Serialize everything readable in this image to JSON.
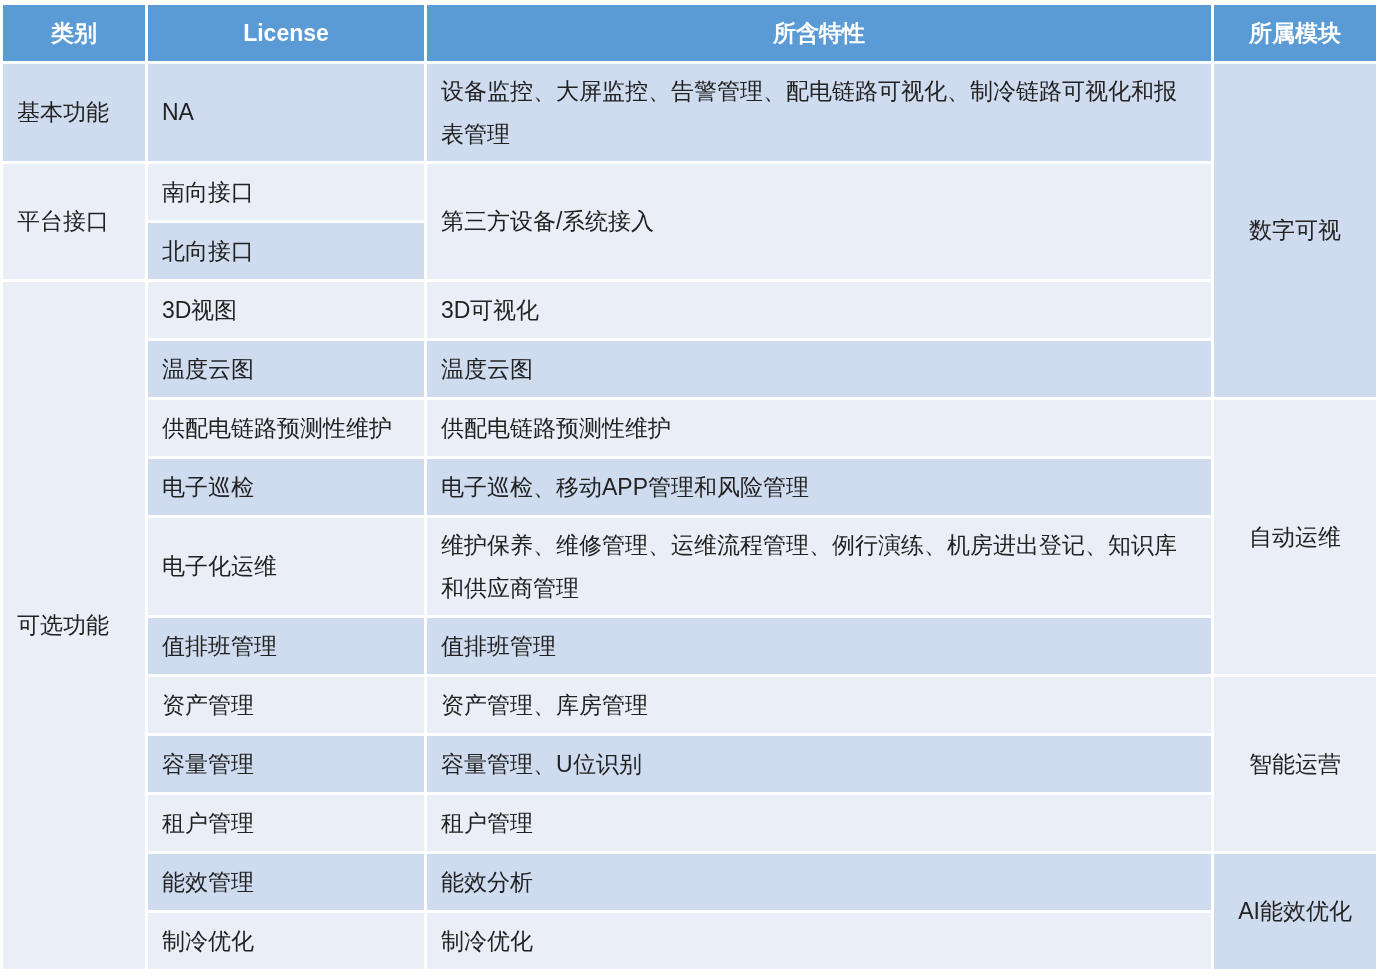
{
  "table": {
    "columns": [
      "类别",
      "License",
      "所含特性",
      "所属模块"
    ],
    "rows": [
      {
        "category": {
          "text": "基本功能",
          "shaded": true
        },
        "license": {
          "text": "NA",
          "shaded": true
        },
        "feature": {
          "text": "设备监控、大屏监控、告警管理、配电链路可视化、制冷链路可视化和报表管理",
          "shaded": true
        },
        "module": {
          "text": "数字可视",
          "shaded": true
        }
      },
      {
        "category": {
          "text": "平台接口",
          "shaded": false
        },
        "license": {
          "text": "南向接口",
          "shaded": false
        },
        "feature": {
          "text": "第三方设备/系统接入",
          "shaded": false
        }
      },
      {
        "license": {
          "text": "北向接口",
          "shaded": true
        }
      },
      {
        "category": {
          "text": "可选功能",
          "shaded": false
        },
        "license": {
          "text": "3D视图",
          "shaded": false
        },
        "feature": {
          "text": "3D可视化",
          "shaded": false
        }
      },
      {
        "license": {
          "text": "温度云图",
          "shaded": true
        },
        "feature": {
          "text": "温度云图",
          "shaded": true
        }
      },
      {
        "license": {
          "text": "供配电链路预测性维护",
          "shaded": false
        },
        "feature": {
          "text": "供配电链路预测性维护",
          "shaded": false
        },
        "module": {
          "text": "自动运维",
          "shaded": false
        }
      },
      {
        "license": {
          "text": "电子巡检",
          "shaded": true
        },
        "feature": {
          "text": "电子巡检、移动APP管理和风险管理",
          "shaded": true
        }
      },
      {
        "license": {
          "text": "电子化运维",
          "shaded": false
        },
        "feature": {
          "text": "维护保养、维修管理、运维流程管理、例行演练、机房进出登记、知识库和供应商管理",
          "shaded": false
        }
      },
      {
        "license": {
          "text": "值排班管理",
          "shaded": true
        },
        "feature": {
          "text": "值排班管理",
          "shaded": true
        }
      },
      {
        "license": {
          "text": "资产管理",
          "shaded": false
        },
        "feature": {
          "text": "资产管理、库房管理",
          "shaded": false
        },
        "module": {
          "text": "智能运营",
          "shaded": false
        }
      },
      {
        "license": {
          "text": "容量管理",
          "shaded": true
        },
        "feature": {
          "text": "容量管理、U位识别",
          "shaded": true
        }
      },
      {
        "license": {
          "text": "租户管理",
          "shaded": false
        },
        "feature": {
          "text": "租户管理",
          "shaded": false
        }
      },
      {
        "license": {
          "text": "能效管理",
          "shaded": true
        },
        "feature": {
          "text": "能效分析",
          "shaded": true
        },
        "module": {
          "text": "AI能效优化",
          "shaded": true
        }
      },
      {
        "license": {
          "text": "制冷优化",
          "shaded": false
        },
        "feature": {
          "text": "制冷优化",
          "shaded": false
        }
      }
    ]
  }
}
